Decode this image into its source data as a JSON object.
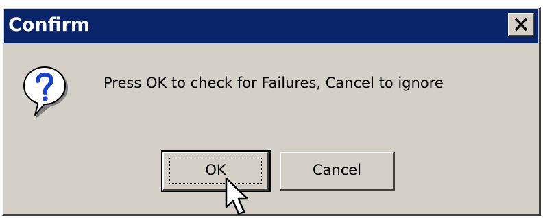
{
  "window": {
    "title": "Confirm",
    "close_label": "×"
  },
  "dialog": {
    "icon": "question-icon",
    "message": "Press OK to check for Failures, Cancel to ignore"
  },
  "buttons": {
    "ok_label": "OK",
    "cancel_label": "Cancel"
  },
  "colors": {
    "titlebar": "#0a246a",
    "dialog_face": "#d4d0c8",
    "icon_question_mark": "#1a44c8"
  }
}
